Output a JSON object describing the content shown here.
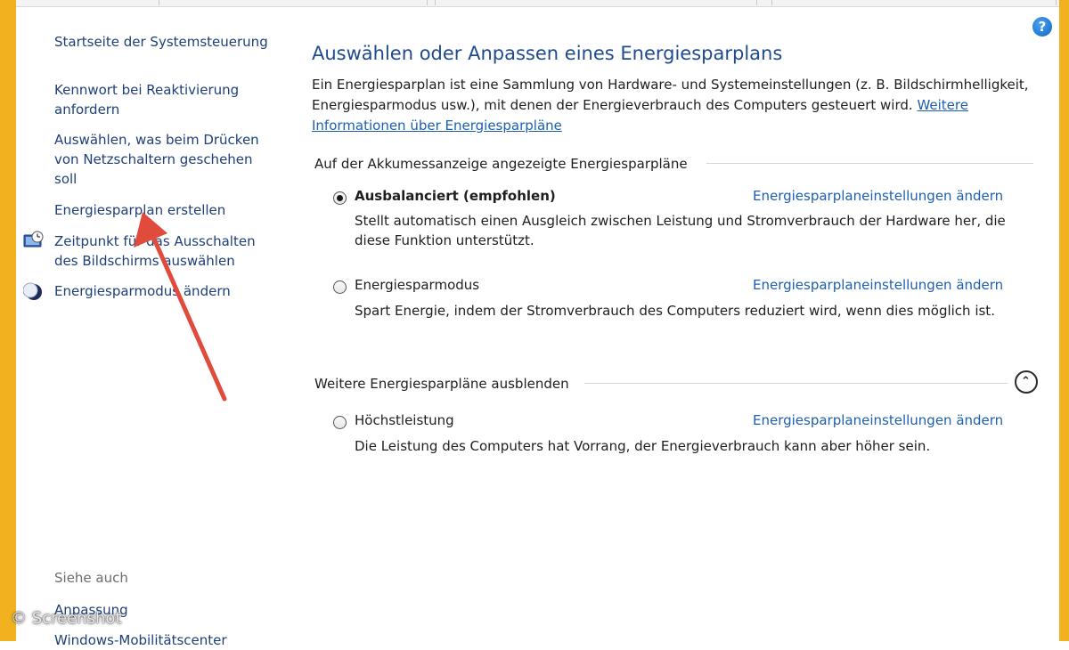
{
  "nav": {
    "home": "Startseite der Systemsteuerung",
    "items": [
      {
        "label": "Kennwort bei Reaktivierung anfordern"
      },
      {
        "label": "Auswählen, was beim Drücken von Netzschaltern geschehen soll"
      },
      {
        "label": "Energiesparplan erstellen"
      },
      {
        "label": "Zeitpunkt für das Ausschalten des Bildschirms auswählen",
        "icon": "clock-monitor-icon"
      },
      {
        "label": "Energiesparmodus ändern",
        "icon": "moon-icon"
      }
    ],
    "see_also": "Siehe auch",
    "see_also_items": [
      "Anpassung",
      "Windows-Mobilitätscenter"
    ]
  },
  "main": {
    "title": "Auswählen oder Anpassen eines Energiesparplans",
    "intro": "Ein Energiesparplan ist eine Sammlung von Hardware- und Systemeinstellungen (z. B. Bildschirmhelligkeit, Energiesparmodus usw.), mit denen der Energieverbrauch des Computers gesteuert wird.",
    "intro_link": "Weitere Informationen über Energiesparpläne",
    "group1_title": "Auf der Akkumessanzeige angezeigte Energiesparpläne",
    "group2_title": "Weitere Energiesparpläne ausblenden",
    "plans": [
      {
        "name": "Ausbalanciert (empfohlen)",
        "selected": true,
        "link": "Energiesparplaneinstellungen ändern",
        "desc": "Stellt automatisch einen Ausgleich zwischen Leistung und Stromverbrauch der Hardware her, die diese Funktion unterstützt."
      },
      {
        "name": "Energiesparmodus",
        "selected": false,
        "link": "Energiesparplaneinstellungen ändern",
        "desc": "Spart Energie, indem der Stromverbrauch des Computers reduziert wird, wenn dies möglich ist."
      },
      {
        "name": "Höchstleistung",
        "selected": false,
        "link": "Energiesparplaneinstellungen ändern",
        "desc": "Die Leistung des Computers hat Vorrang, der Energieverbrauch kann aber höher sein."
      }
    ]
  },
  "help_icon": "?",
  "watermark": "© Screenshot",
  "colors": {
    "frame": "#f2b21f",
    "link": "#1d5fb0",
    "title": "#1e4a8e",
    "arrow": "#e04b3c"
  }
}
